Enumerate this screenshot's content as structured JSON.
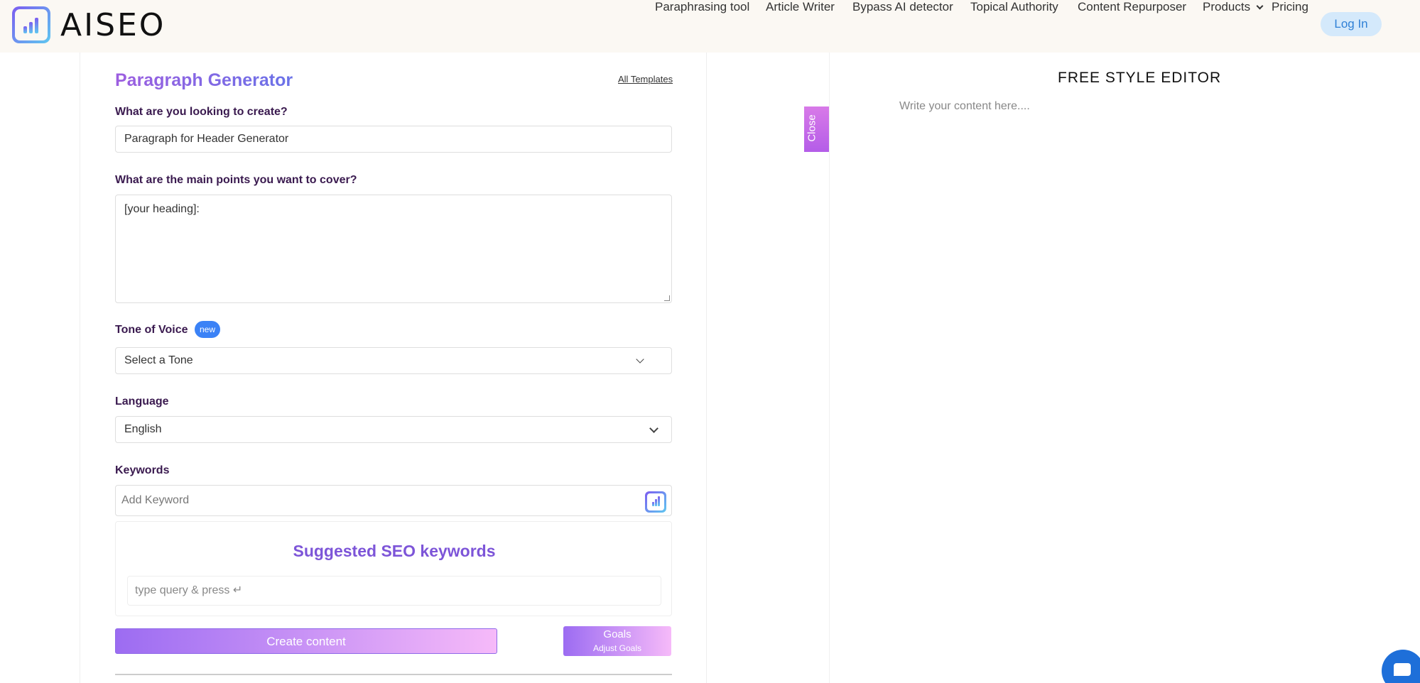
{
  "header": {
    "logo_text": "AISEO",
    "nav": [
      {
        "label": "Paraphrasing tool"
      },
      {
        "label": "Article Writer"
      },
      {
        "label": "Bypass AI detector"
      },
      {
        "label": "Topical Authority"
      },
      {
        "label": "Content Repurposer"
      },
      {
        "label": "Products"
      },
      {
        "label": "Pricing"
      }
    ],
    "login_label": "Log In"
  },
  "form": {
    "title": "Paragraph Generator",
    "all_templates": "All Templates",
    "create_label": "What are you looking to create?",
    "create_value": "Paragraph for Header Generator",
    "points_label": "What are the main points you want to cover?",
    "points_value": "[your heading]:",
    "tone_label": "Tone of Voice",
    "tone_badge": "new",
    "tone_value": "Select a Tone",
    "language_label": "Language",
    "language_value": "English",
    "keywords_label": "Keywords",
    "keyword_placeholder": "Add Keyword",
    "seo_title": "Suggested SEO keywords",
    "seo_placeholder": "type query & press ↵",
    "create_button": "Create content",
    "goals_button": "Goals",
    "adjust_goals": "Adjust Goals"
  },
  "editor": {
    "close_label": "Close",
    "title": "FREE STYLE EDITOR",
    "placeholder": "Write your content here...."
  },
  "colors": {
    "accent_gradient_start": "#9c6cf2",
    "accent_gradient_end": "#f6baf9",
    "badge_blue": "#3b82f6",
    "login_bg": "#d4e9fb"
  }
}
